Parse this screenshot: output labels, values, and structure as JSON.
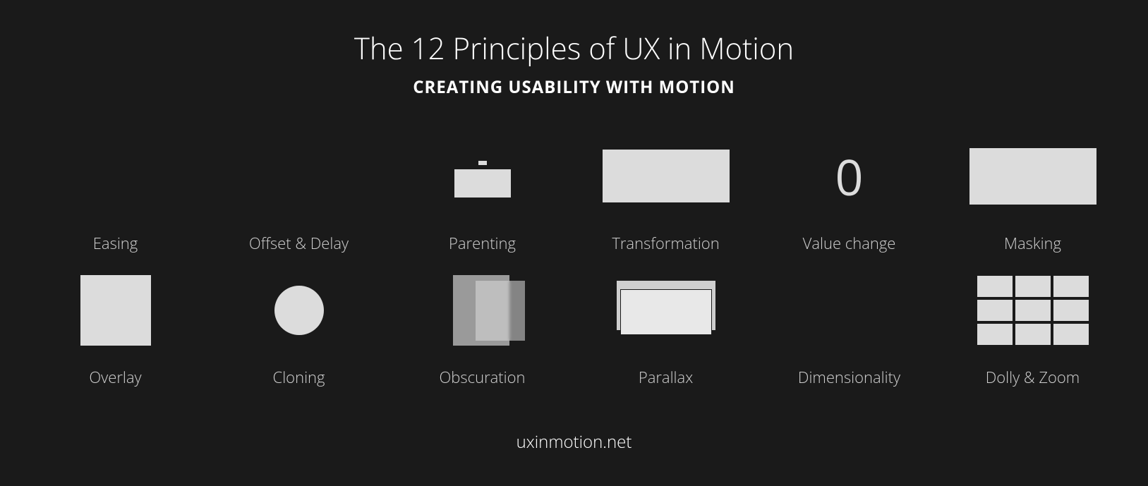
{
  "title": "The 12 Principles of UX in Motion",
  "subtitle": "CREATING USABILITY WITH MOTION",
  "footer": "uxinmotion.net",
  "value_change_digit": "0",
  "principles": [
    {
      "label": "Easing"
    },
    {
      "label": "Offset & Delay"
    },
    {
      "label": "Parenting"
    },
    {
      "label": "Transformation"
    },
    {
      "label": "Value change"
    },
    {
      "label": "Masking"
    },
    {
      "label": "Overlay"
    },
    {
      "label": "Cloning"
    },
    {
      "label": "Obscuration"
    },
    {
      "label": "Parallax"
    },
    {
      "label": "Dimensionality"
    },
    {
      "label": "Dolly & Zoom"
    }
  ]
}
